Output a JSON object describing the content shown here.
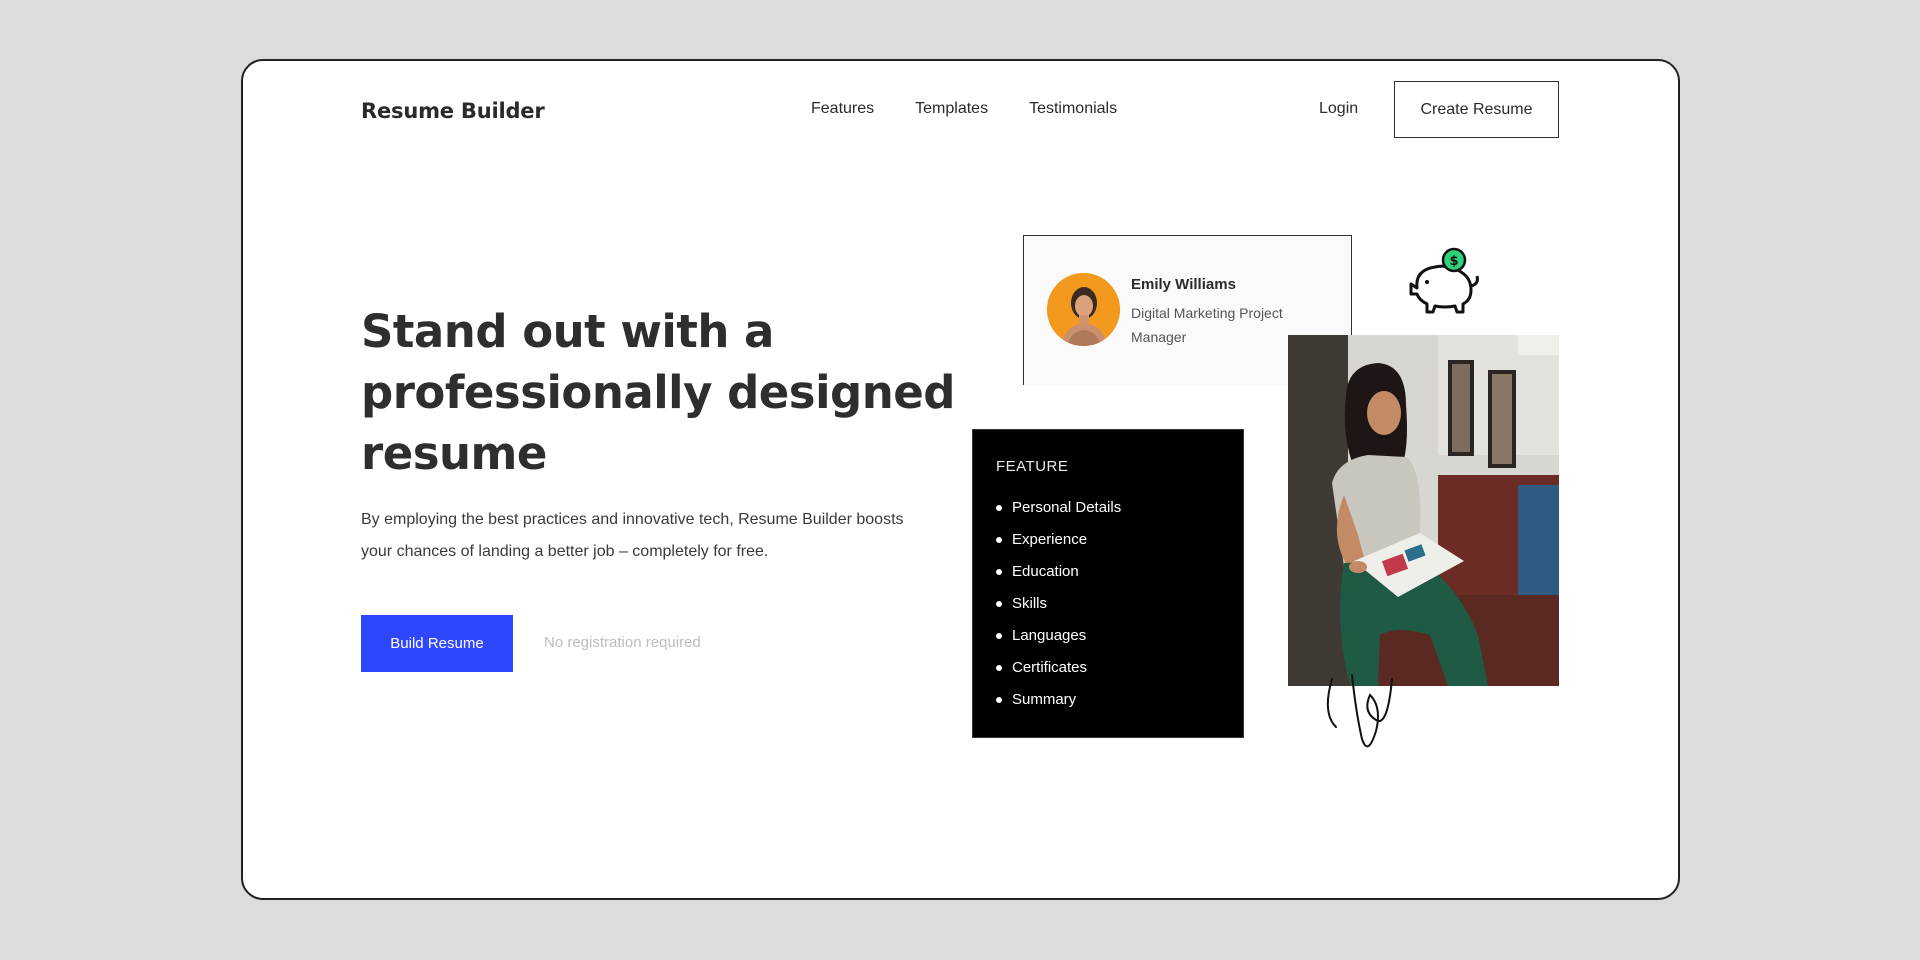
{
  "brand": "Resume Builder",
  "nav": {
    "links": [
      "Features",
      "Templates",
      "Testimonials"
    ],
    "login": "Login",
    "cta": "Create Resume"
  },
  "hero": {
    "headline_lines": [
      "Stand out with a",
      "professionally designed",
      "resume"
    ],
    "subtext_lines": [
      "By employing the best practices and innovative tech, Resume Builder boosts",
      "your chances of landing a better job – completely for free."
    ],
    "button": "Build Resume",
    "note": "No registration required"
  },
  "profile": {
    "name": "Emily Williams",
    "role_lines": [
      "Digital Marketing Project",
      "Manager"
    ]
  },
  "piggy_coin": "$",
  "features": {
    "title": "FEATURE",
    "items": [
      "Personal Details",
      "Experience",
      "Education",
      "Skills",
      "Languages",
      "Certificates",
      "Summary"
    ]
  },
  "colors": {
    "accent": "#2f46ff",
    "avatar_bg": "#f39a1e",
    "coin": "#2fd17a"
  }
}
